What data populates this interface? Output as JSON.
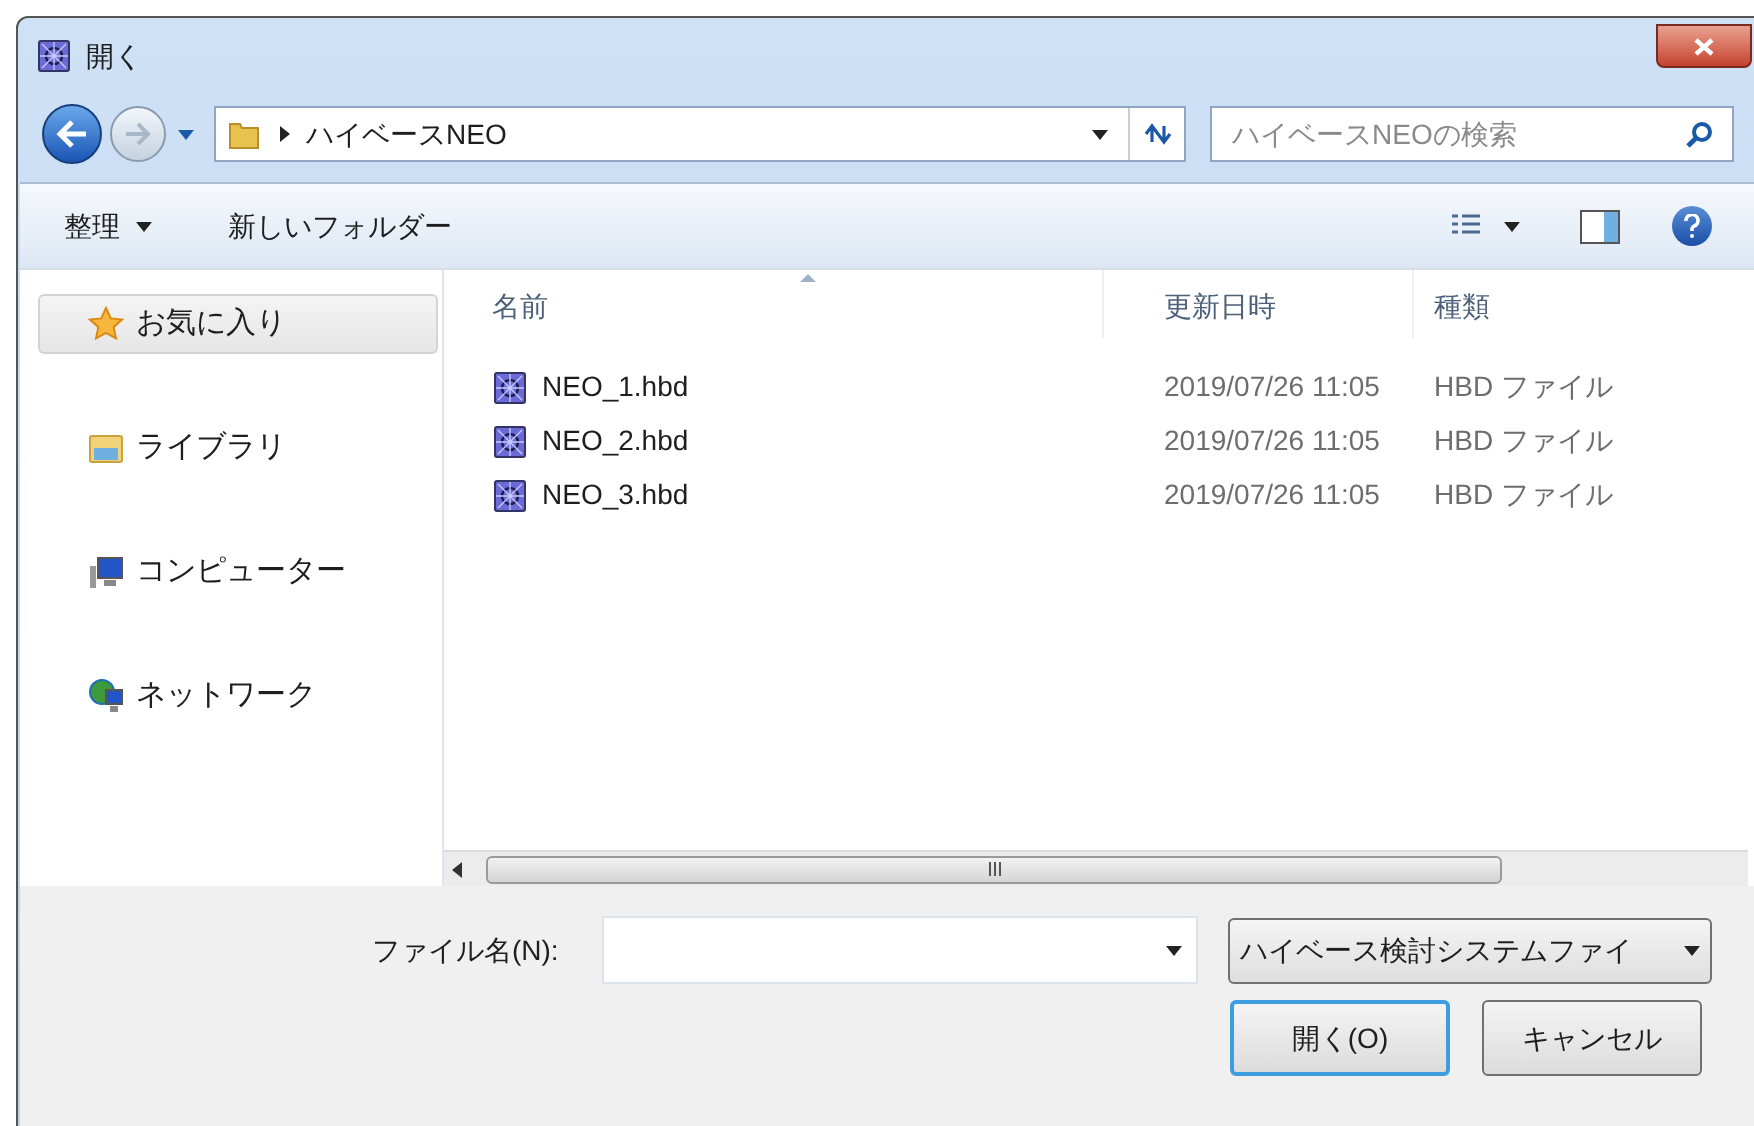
{
  "window": {
    "title": "開く"
  },
  "address": {
    "path": "ハイベースNEO",
    "search_placeholder": "ハイベースNEOの検索"
  },
  "toolbar": {
    "organize": "整理",
    "new_folder": "新しいフォルダー"
  },
  "sidebar": {
    "items": [
      {
        "label": "お気に入り",
        "kind": "star",
        "selected": true
      },
      {
        "label": "ライブラリ",
        "kind": "library",
        "selected": false
      },
      {
        "label": "コンピューター",
        "kind": "computer",
        "selected": false
      },
      {
        "label": "ネットワーク",
        "kind": "network",
        "selected": false
      }
    ]
  },
  "table": {
    "columns": [
      "名前",
      "更新日時",
      "種類"
    ],
    "rows": [
      {
        "name": "NEO_1.hbd",
        "modified": "2019/07/26 11:05",
        "type": "HBD ファイル",
        "selected": false
      },
      {
        "name": "NEO_2.hbd",
        "modified": "2019/07/26 11:05",
        "type": "HBD ファイル",
        "selected": false
      },
      {
        "name": "NEO_3.hbd",
        "modified": "2019/07/26 11:05",
        "type": "HBD ファイル",
        "selected": false
      }
    ]
  },
  "footer": {
    "filename_label": "ファイル名(N):",
    "file_type": "ハイベース検討システムファイ",
    "buttons": [
      {
        "label": "開く(O)",
        "default": true
      },
      {
        "label": "キャンセル",
        "default": false
      }
    ]
  }
}
